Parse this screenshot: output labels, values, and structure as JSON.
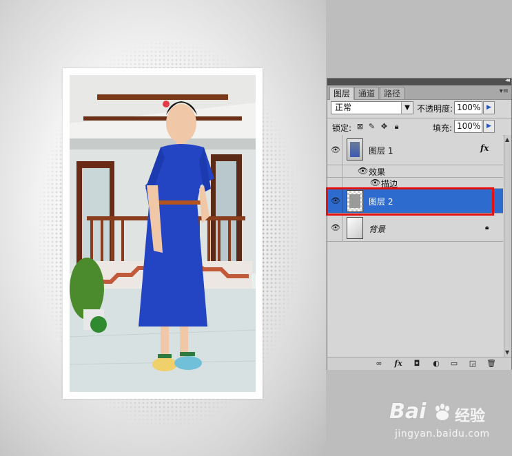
{
  "canvas": {
    "description_icon": "photo-layer-preview"
  },
  "panel": {
    "collapse": "◂◂",
    "menu": "▾≡",
    "tabs": [
      {
        "label": "图层",
        "active": true
      },
      {
        "label": "通道",
        "active": false
      },
      {
        "label": "路径",
        "active": false
      }
    ],
    "blend_mode": "正常",
    "opacity_label": "不透明度:",
    "opacity_value": "100%",
    "lock_label": "锁定:",
    "fill_label": "填充:",
    "fill_value": "100%"
  },
  "layers": [
    {
      "name": "图层 1",
      "fx": "fx",
      "selected": false
    },
    {
      "name": "效果",
      "type": "effects-group"
    },
    {
      "name": "描边",
      "type": "effect"
    },
    {
      "name": "图层 2",
      "selected": true
    },
    {
      "name": "背景",
      "locked": true
    }
  ],
  "watermark": {
    "logo": "Bai",
    "logo2": "经验",
    "url": "jingyan.baidu.com"
  },
  "colors": {
    "selection": "#2d6bcf",
    "highlight_box": "#e51010",
    "panel_bg": "#d6d6d6"
  }
}
